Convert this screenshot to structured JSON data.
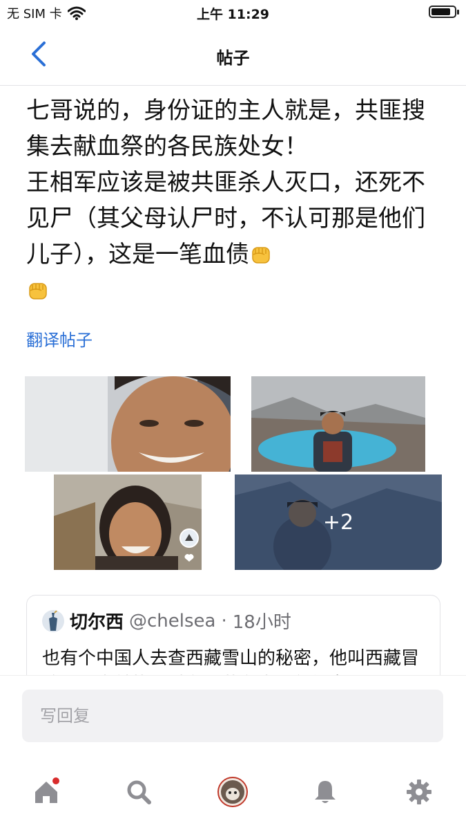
{
  "status_bar": {
    "carrier": "无 SIM 卡",
    "time": "上午 11:29",
    "battery_level": 0.85
  },
  "nav": {
    "title": "帖子",
    "back_icon": "chevron-left-icon"
  },
  "post": {
    "text": "七哥说的，身份证的主人就是，共匪搜集去献血祭的各民族处女！\n王相军应该是被共匪杀人灭口，还死不见尸（其父母认尸时，不认可那是他们儿子），这是一笔血债",
    "emoji": [
      "raised-fist-icon",
      "raised-fist-icon"
    ],
    "translate_label": "翻译帖子",
    "more_photos": "+2"
  },
  "quote": {
    "name": "切尔西",
    "handle": "@chelsea",
    "separator": "·",
    "time": "18小时",
    "text": "也有个中国人去查西藏雪山的秘密，他叫西藏冒险王，生前找到过有西藏有大量年轻女"
  },
  "reply": {
    "placeholder": "写回复"
  },
  "tabs": [
    "home-icon",
    "search-icon",
    "profile-avatar-icon",
    "bell-icon",
    "gear-icon"
  ],
  "colors": {
    "link": "#2a6fd6",
    "badge": "#d92c2c",
    "tab_icon": "#8e8e93"
  }
}
